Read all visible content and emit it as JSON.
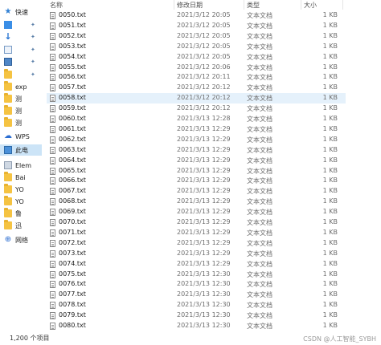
{
  "nav": {
    "items": [
      {
        "label": "快速",
        "icon": "star-icon",
        "kind": "star",
        "pin": false
      },
      {
        "label": "",
        "icon": "desktop-icon",
        "kind": "blue-sq",
        "pin": true
      },
      {
        "label": "",
        "icon": "download-icon",
        "kind": "arrow-down",
        "pin": true
      },
      {
        "label": "",
        "icon": "document-icon",
        "kind": "doc",
        "pin": true
      },
      {
        "label": "",
        "icon": "picture-icon",
        "kind": "pic",
        "pin": true
      },
      {
        "label": "",
        "icon": "folder-icon",
        "kind": "folder",
        "pin": true
      },
      {
        "label": "exp",
        "icon": "folder-icon",
        "kind": "folder",
        "pin": false
      },
      {
        "label": "测",
        "icon": "folder-icon",
        "kind": "folder",
        "pin": false
      },
      {
        "label": "测",
        "icon": "folder-icon",
        "kind": "folder",
        "pin": false
      },
      {
        "label": "测",
        "icon": "folder-icon",
        "kind": "folder",
        "pin": false
      },
      {
        "label": "WPS",
        "icon": "cloud-icon",
        "kind": "cloud",
        "pin": false
      },
      {
        "label": "此电",
        "icon": "computer-icon",
        "kind": "pc",
        "pin": false
      },
      {
        "label": "Elem",
        "icon": "drive-icon",
        "kind": "drive",
        "pin": false
      },
      {
        "label": "Bai",
        "icon": "folder-icon",
        "kind": "folder",
        "pin": false
      },
      {
        "label": "YO",
        "icon": "folder-icon",
        "kind": "folder",
        "pin": false
      },
      {
        "label": "YO",
        "icon": "folder-icon",
        "kind": "folder",
        "pin": false
      },
      {
        "label": "鲁",
        "icon": "folder-icon",
        "kind": "folder",
        "pin": false
      },
      {
        "label": "迅",
        "icon": "folder-icon",
        "kind": "folder",
        "pin": false
      },
      {
        "label": "网络",
        "icon": "network-icon",
        "kind": "netw",
        "pin": false
      }
    ]
  },
  "columns": {
    "name": "名称",
    "date": "修改日期",
    "type": "类型",
    "size": "大小"
  },
  "files": [
    {
      "name": "0050.txt",
      "date": "2021/3/12 20:05",
      "type": "文本文档",
      "size": "1 KB"
    },
    {
      "name": "0051.txt",
      "date": "2021/3/12 20:05",
      "type": "文本文档",
      "size": "1 KB"
    },
    {
      "name": "0052.txt",
      "date": "2021/3/12 20:05",
      "type": "文本文档",
      "size": "1 KB"
    },
    {
      "name": "0053.txt",
      "date": "2021/3/12 20:05",
      "type": "文本文档",
      "size": "1 KB"
    },
    {
      "name": "0054.txt",
      "date": "2021/3/12 20:05",
      "type": "文本文档",
      "size": "1 KB"
    },
    {
      "name": "0055.txt",
      "date": "2021/3/12 20:06",
      "type": "文本文档",
      "size": "1 KB"
    },
    {
      "name": "0056.txt",
      "date": "2021/3/12 20:11",
      "type": "文本文档",
      "size": "1 KB"
    },
    {
      "name": "0057.txt",
      "date": "2021/3/12 20:12",
      "type": "文本文档",
      "size": "1 KB"
    },
    {
      "name": "0058.txt",
      "date": "2021/3/12 20:12",
      "type": "文本文档",
      "size": "1 KB",
      "selected": true
    },
    {
      "name": "0059.txt",
      "date": "2021/3/12 20:12",
      "type": "文本文档",
      "size": "1 KB"
    },
    {
      "name": "0060.txt",
      "date": "2021/3/13 12:28",
      "type": "文本文档",
      "size": "1 KB"
    },
    {
      "name": "0061.txt",
      "date": "2021/3/13 12:29",
      "type": "文本文档",
      "size": "1 KB"
    },
    {
      "name": "0062.txt",
      "date": "2021/3/13 12:29",
      "type": "文本文档",
      "size": "1 KB"
    },
    {
      "name": "0063.txt",
      "date": "2021/3/13 12:29",
      "type": "文本文档",
      "size": "1 KB"
    },
    {
      "name": "0064.txt",
      "date": "2021/3/13 12:29",
      "type": "文本文档",
      "size": "1 KB"
    },
    {
      "name": "0065.txt",
      "date": "2021/3/13 12:29",
      "type": "文本文档",
      "size": "1 KB"
    },
    {
      "name": "0066.txt",
      "date": "2021/3/13 12:29",
      "type": "文本文档",
      "size": "1 KB"
    },
    {
      "name": "0067.txt",
      "date": "2021/3/13 12:29",
      "type": "文本文档",
      "size": "1 KB"
    },
    {
      "name": "0068.txt",
      "date": "2021/3/13 12:29",
      "type": "文本文档",
      "size": "1 KB"
    },
    {
      "name": "0069.txt",
      "date": "2021/3/13 12:29",
      "type": "文本文档",
      "size": "1 KB"
    },
    {
      "name": "0070.txt",
      "date": "2021/3/13 12:29",
      "type": "文本文档",
      "size": "1 KB"
    },
    {
      "name": "0071.txt",
      "date": "2021/3/13 12:29",
      "type": "文本文档",
      "size": "1 KB"
    },
    {
      "name": "0072.txt",
      "date": "2021/3/13 12:29",
      "type": "文本文档",
      "size": "1 KB"
    },
    {
      "name": "0073.txt",
      "date": "2021/3/13 12:29",
      "type": "文本文档",
      "size": "1 KB"
    },
    {
      "name": "0074.txt",
      "date": "2021/3/13 12:29",
      "type": "文本文档",
      "size": "1 KB"
    },
    {
      "name": "0075.txt",
      "date": "2021/3/13 12:30",
      "type": "文本文档",
      "size": "1 KB"
    },
    {
      "name": "0076.txt",
      "date": "2021/3/13 12:30",
      "type": "文本文档",
      "size": "1 KB"
    },
    {
      "name": "0077.txt",
      "date": "2021/3/13 12:30",
      "type": "文本文档",
      "size": "1 KB"
    },
    {
      "name": "0078.txt",
      "date": "2021/3/13 12:30",
      "type": "文本文档",
      "size": "1 KB"
    },
    {
      "name": "0079.txt",
      "date": "2021/3/13 12:30",
      "type": "文本文档",
      "size": "1 KB"
    },
    {
      "name": "0080.txt",
      "date": "2021/3/13 12:30",
      "type": "文本文档",
      "size": "1 KB"
    }
  ],
  "status": {
    "item_count": "1,200 个项目"
  },
  "watermark": "CSDN @人工智能_SYBH",
  "colors": {
    "selection": "#e5f1fb",
    "nav_selection": "#cce4f7",
    "folder": "#f5c342",
    "accent": "#2f7fd3"
  }
}
